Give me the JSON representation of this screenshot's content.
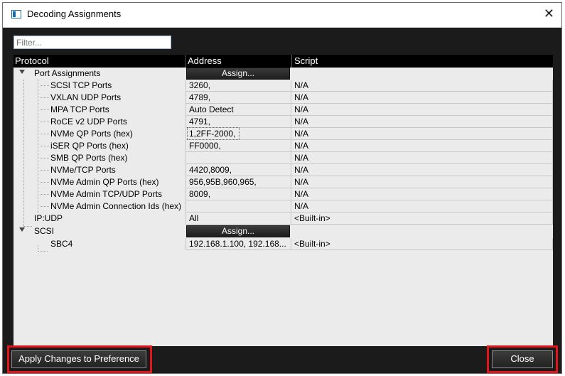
{
  "window": {
    "title": "Decoding Assignments",
    "close_glyph": "✕"
  },
  "filter": {
    "placeholder": "Filter...",
    "value": ""
  },
  "columns": [
    "Protocol",
    "Address",
    "Script"
  ],
  "assign_label": "Assign...",
  "rows": [
    {
      "protocol": "Port Assignments",
      "address": "",
      "script": "",
      "group": true
    },
    {
      "protocol": "SCSI TCP Ports",
      "address": "3260,",
      "script": "N/A"
    },
    {
      "protocol": "VXLAN UDP Ports",
      "address": "4789,",
      "script": "N/A"
    },
    {
      "protocol": "MPA TCP Ports",
      "address": "Auto Detect",
      "script": "N/A"
    },
    {
      "protocol": "RoCE v2 UDP Ports",
      "address": "4791,",
      "script": "N/A"
    },
    {
      "protocol": "NVMe QP Ports (hex)",
      "address": "1,2FF-2000,",
      "script": "N/A"
    },
    {
      "protocol": "iSER QP Ports (hex)",
      "address": "FF0000,",
      "script": "N/A"
    },
    {
      "protocol": "SMB QP Ports (hex)",
      "address": "",
      "script": "N/A"
    },
    {
      "protocol": "NVMe/TCP Ports",
      "address": "4420,8009,",
      "script": "N/A"
    },
    {
      "protocol": "NVMe Admin QP Ports (hex)",
      "address": "956,95B,960,965,",
      "script": "N/A"
    },
    {
      "protocol": "NVMe Admin TCP/UDP Ports",
      "address": "8009,",
      "script": "N/A"
    },
    {
      "protocol": "NVMe Admin Connection Ids (hex)",
      "address": "",
      "script": "N/A"
    },
    {
      "protocol": "IP:UDP",
      "address": "All",
      "script": "<Built-in>"
    },
    {
      "protocol": "SCSI",
      "address": "",
      "script": "",
      "group": true
    },
    {
      "protocol": "SBC4",
      "address": "192.168.1.100, 192.168...",
      "script": "<Built-in>"
    }
  ],
  "buttons": {
    "apply": "Apply Changes to Preference",
    "close": "Close"
  },
  "colors": {
    "highlight": "#e0161b",
    "dialog_bg": "#1b1b1b",
    "tree_bg": "#ebebeb"
  }
}
